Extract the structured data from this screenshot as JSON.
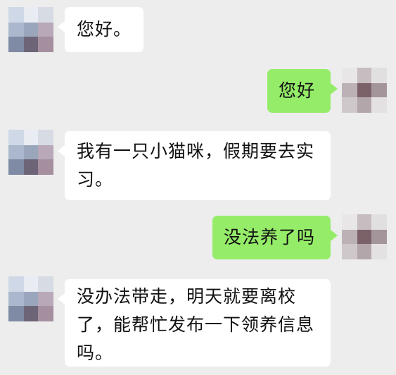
{
  "theme": {
    "background": "#ededed",
    "incoming_bubble": "#ffffff",
    "outgoing_bubble": "#95ec69"
  },
  "messages": [
    {
      "from": "other",
      "text": "您好。",
      "avatar_icon": "blurred-avatar-icon"
    },
    {
      "from": "me",
      "text": "您好",
      "avatar_icon": "blurred-avatar-icon"
    },
    {
      "from": "other",
      "text": "我有一只小猫咪，假期要去实习。",
      "avatar_icon": "blurred-avatar-icon"
    },
    {
      "from": "me",
      "text": "没法养了吗",
      "avatar_icon": "blurred-avatar-icon"
    },
    {
      "from": "other",
      "text": "没办法带走，明天就要离校了，能帮忙发布一下领养信息吗。",
      "avatar_icon": "blurred-avatar-icon"
    }
  ]
}
